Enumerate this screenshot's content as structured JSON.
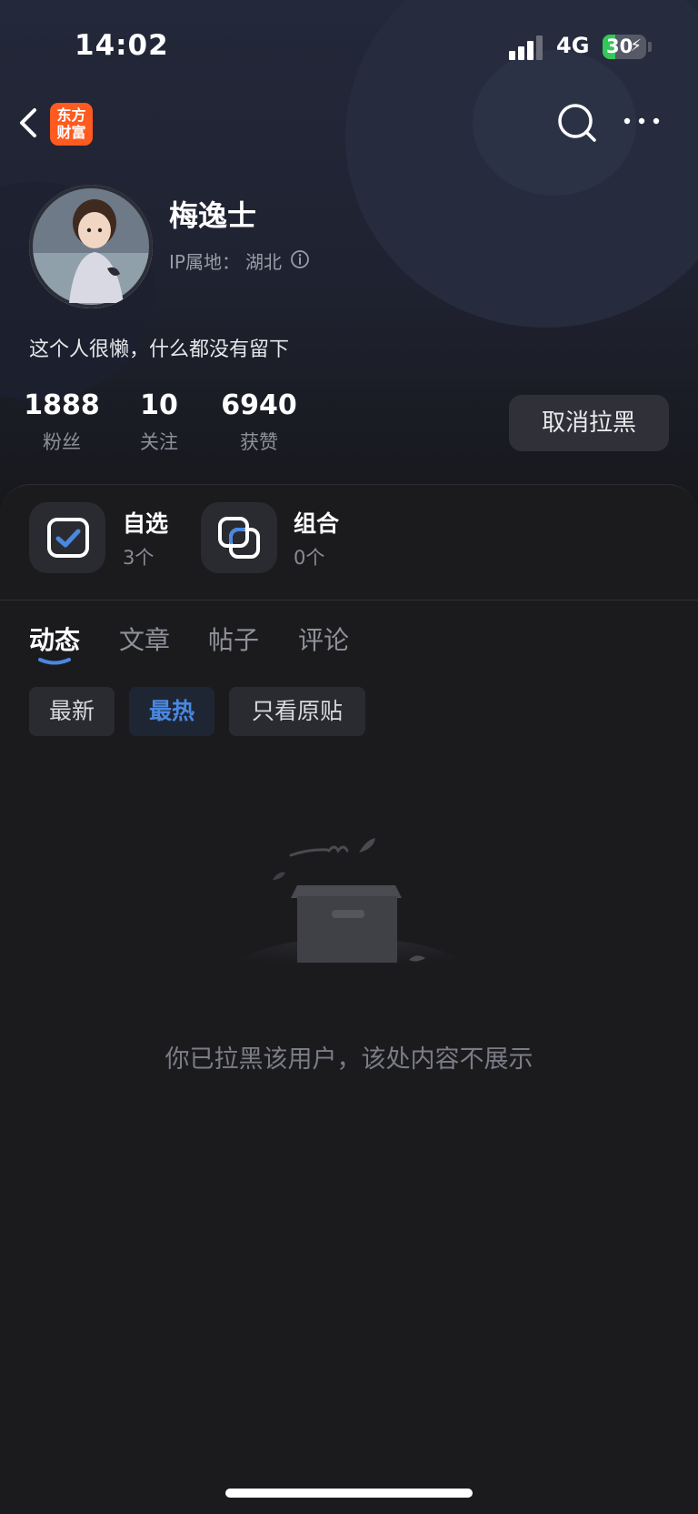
{
  "status_bar": {
    "time": "14:02",
    "network": "4G",
    "battery_level": "30",
    "battery_color": "#34c759"
  },
  "nav": {
    "back_icon": "chevron-left-icon",
    "app_logo": {
      "line1": "东方",
      "line2": "财富",
      "color": "#ff5a1f"
    },
    "search_icon": "search-icon",
    "more_icon": "more-horizontal-icon"
  },
  "profile": {
    "username": "梅逸士",
    "ip_label": "IP属地：",
    "ip_location": "湖北",
    "bio": "这个人很懒，什么都没有留下",
    "stats": [
      {
        "value": "1888",
        "label": "粉丝"
      },
      {
        "value": "10",
        "label": "关注"
      },
      {
        "value": "6940",
        "label": "获赞"
      }
    ],
    "unblock_button": "取消拉黑"
  },
  "shortcuts": [
    {
      "title": "自选",
      "subtitle": "3个",
      "icon": "checkbox-icon"
    },
    {
      "title": "组合",
      "subtitle": "0个",
      "icon": "overlap-squares-icon"
    }
  ],
  "tabs": [
    {
      "label": "动态",
      "active": true
    },
    {
      "label": "文章",
      "active": false
    },
    {
      "label": "帖子",
      "active": false
    },
    {
      "label": "评论",
      "active": false
    }
  ],
  "filters": [
    {
      "label": "最新",
      "active": false
    },
    {
      "label": "最热",
      "active": true
    },
    {
      "label": "只看原贴",
      "active": false
    }
  ],
  "empty_state": {
    "icon": "empty-box-icon",
    "message": "你已拉黑该用户，该处内容不展示"
  },
  "accent_color": "#4a88e0"
}
